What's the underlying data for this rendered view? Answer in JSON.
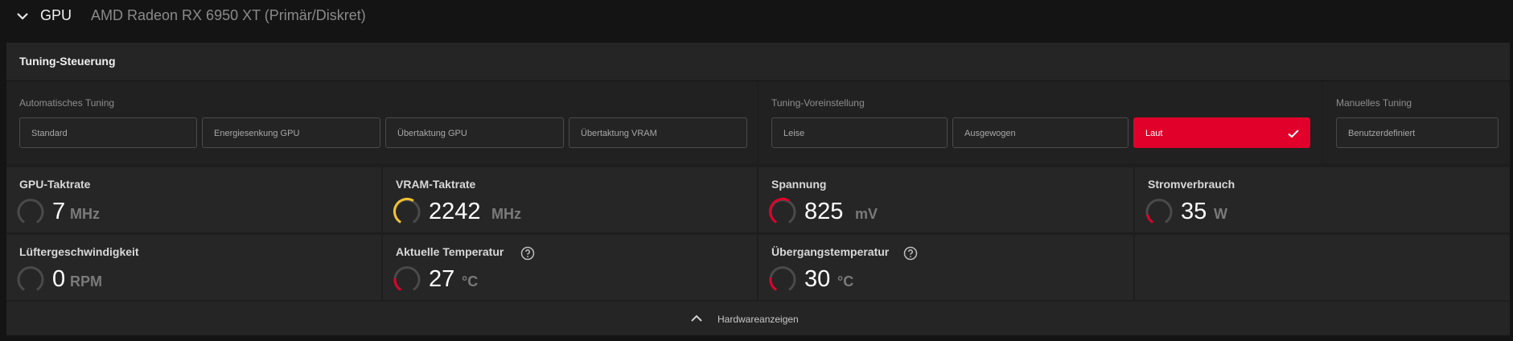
{
  "header": {
    "section": "GPU",
    "device": "AMD Radeon RX 6950 XT (Primär/Diskret)"
  },
  "panel": {
    "title": "Tuning-Steuerung",
    "auto_tuning": {
      "label": "Automatisches Tuning",
      "options": [
        "Standard",
        "Energiesenkung GPU",
        "Übertaktung GPU",
        "Übertaktung VRAM"
      ]
    },
    "presets": {
      "label": "Tuning-Voreinstellung",
      "options": [
        "Leise",
        "Ausgewogen",
        "Laut"
      ],
      "selected": "Laut"
    },
    "manual": {
      "label": "Manuelles Tuning",
      "option": "Benutzerdefiniert"
    },
    "metrics": {
      "gpu_clock": {
        "title": "GPU-Taktrate",
        "value": "7",
        "unit": "MHz",
        "level": 0.0
      },
      "vram_clock": {
        "title": "VRAM-Taktrate",
        "value": "2242",
        "unit": "MHz",
        "level": 0.3
      },
      "voltage": {
        "title": "Spannung",
        "value": "825",
        "unit": "mV",
        "level": 0.3
      },
      "power": {
        "title": "Stromverbrauch",
        "value": "35",
        "unit": "W",
        "level": 0.1
      },
      "fan_speed": {
        "title": "Lüftergeschwindigkeit",
        "value": "0",
        "unit": "RPM",
        "level": 0.0
      },
      "current_temp": {
        "title": "Aktuelle Temperatur",
        "value": "27",
        "unit": "°C",
        "level": 0.2
      },
      "junction_temp": {
        "title": "Übergangstemperatur",
        "value": "30",
        "unit": "°C",
        "level": 0.2
      }
    },
    "footer": {
      "label": "Hardwareanzeigen"
    }
  },
  "colors": {
    "accent_red": "#e0002a",
    "gauge_yellow": "#f2c230",
    "gauge_track": "#4a4a4a"
  },
  "icons": {
    "collapse": "chevron-down-icon",
    "expand": "chevron-up-icon",
    "selected": "check-icon",
    "help": "help-circle-icon"
  }
}
